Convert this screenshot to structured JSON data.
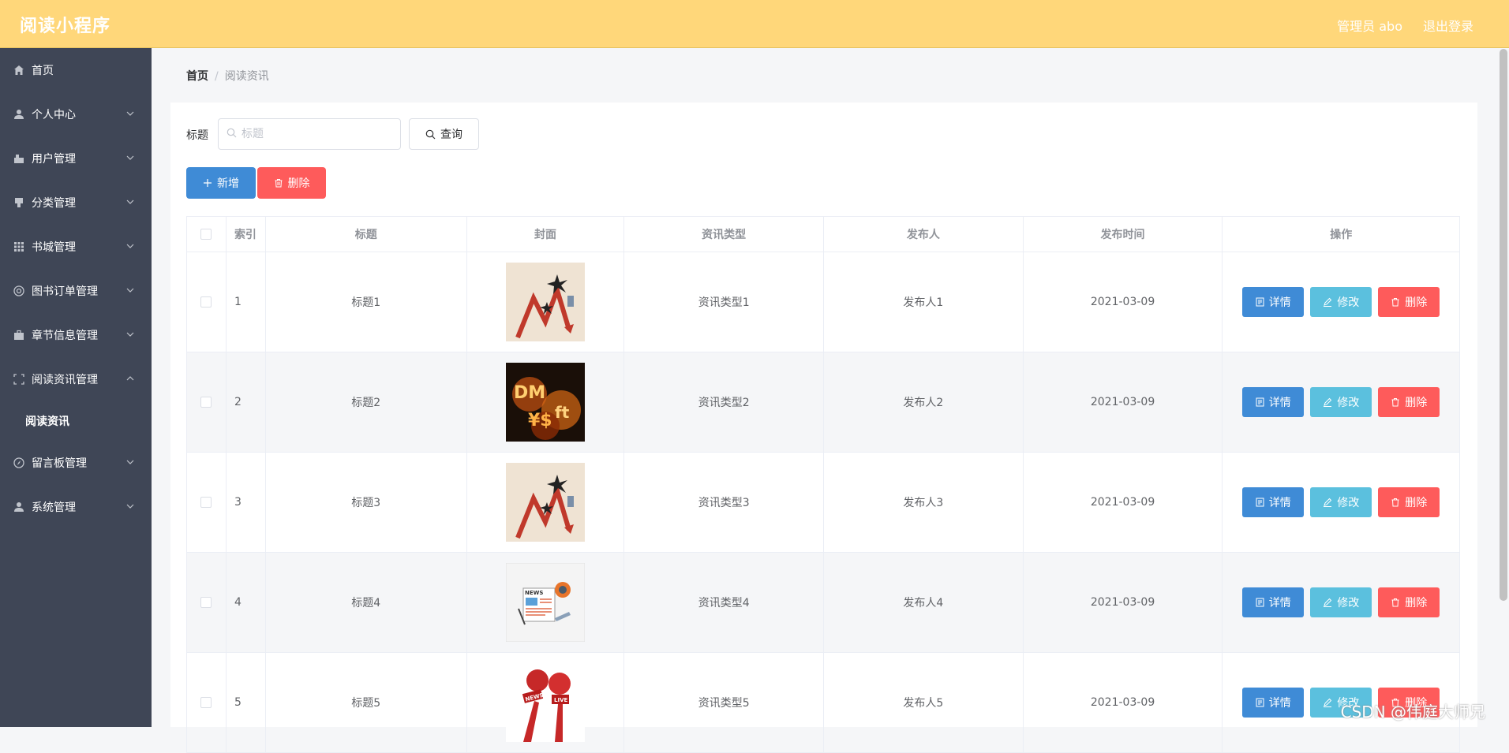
{
  "header": {
    "brand": "阅读小程序",
    "admin": "管理员 abo",
    "logout": "退出登录"
  },
  "sidebar": {
    "items": [
      {
        "label": "首页",
        "icon": "home-icon",
        "expandable": false
      },
      {
        "label": "个人中心",
        "icon": "user-icon",
        "expandable": true
      },
      {
        "label": "用户管理",
        "icon": "users-icon",
        "expandable": true
      },
      {
        "label": "分类管理",
        "icon": "category-icon",
        "expandable": true
      },
      {
        "label": "书城管理",
        "icon": "grid-icon",
        "expandable": true
      },
      {
        "label": "图书订单管理",
        "icon": "order-icon",
        "expandable": true
      },
      {
        "label": "章节信息管理",
        "icon": "briefcase-icon",
        "expandable": true
      },
      {
        "label": "阅读资讯管理",
        "icon": "frame-icon",
        "expandable": true,
        "expanded": true
      },
      {
        "label": "留言板管理",
        "icon": "compass-icon",
        "expandable": true
      },
      {
        "label": "系统管理",
        "icon": "user-icon",
        "expandable": true
      }
    ],
    "submenu": {
      "label": "阅读资讯"
    }
  },
  "breadcrumb": {
    "home": "首页",
    "separator": "/",
    "current": "阅读资讯"
  },
  "search": {
    "label": "标题",
    "placeholder": "标题",
    "query_label": "查询"
  },
  "actions": {
    "add_label": "新增",
    "delete_label": "删除"
  },
  "table": {
    "headers": {
      "index": "索引",
      "title": "标题",
      "cover": "封面",
      "type": "资讯类型",
      "publisher": "发布人",
      "time": "发布时间",
      "ops": "操作"
    },
    "rows": [
      {
        "index": "1",
        "title": "标题1",
        "cover": "chart-arrow-image",
        "type": "资讯类型1",
        "publisher": "发布人1",
        "time": "2021-03-09"
      },
      {
        "index": "2",
        "title": "标题2",
        "cover": "currency-fire-image",
        "type": "资讯类型2",
        "publisher": "发布人2",
        "time": "2021-03-09"
      },
      {
        "index": "3",
        "title": "标题3",
        "cover": "chart-arrow-image",
        "type": "资讯类型3",
        "publisher": "发布人3",
        "time": "2021-03-09"
      },
      {
        "index": "4",
        "title": "标题4",
        "cover": "newspaper-image",
        "type": "资讯类型4",
        "publisher": "发布人4",
        "time": "2021-03-09"
      },
      {
        "index": "5",
        "title": "标题5",
        "cover": "microphone-image",
        "type": "资讯类型5",
        "publisher": "发布人5",
        "time": "2021-03-09"
      }
    ],
    "ops": {
      "detail": "详情",
      "edit": "修改",
      "delete": "删除"
    }
  },
  "watermark": "CSDN @伟庭大师兄",
  "colors": {
    "header": "#ffd77a",
    "sidebar": "#3f4656",
    "primary": "#3f8bd6",
    "info": "#5bc0de",
    "danger": "#fe5b5b"
  }
}
